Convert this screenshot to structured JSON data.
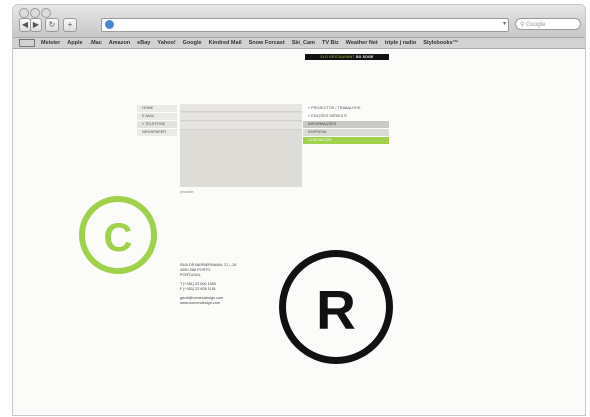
{
  "browser": {
    "search_placeholder": "Google",
    "bookmarks": [
      "Meister",
      "Apple",
      ".Mac",
      "Amazon",
      "eBay",
      "Yahoo!",
      "Google",
      "Kindred Mail",
      "Snow Forcast",
      "Ski_Cam",
      "TV Biz",
      "Weather Net",
      "triple j radio",
      "Stylebooks™"
    ]
  },
  "site": {
    "topbar_prefix": "ELO RESTAURANT",
    "topbar_highlight": "DO SOGE",
    "left_menu": [
      "HOME",
      "E-MAIL",
      "« TELEFONE",
      "NEWSPAPER"
    ],
    "right_menu": [
      {
        "label": "» PROJECTOS / TRABALHOS",
        "style": "light"
      },
      {
        "label": "» EDIÇÕES SÉRIES R",
        "style": "light"
      },
      {
        "label": "INFORMAÇÕES",
        "style": "grey"
      },
      {
        "label": "EMPRESA",
        "style": "grey2"
      },
      {
        "label": "CONTACTOS",
        "style": "green"
      }
    ],
    "caption": "printable",
    "logo_c_letter": "C",
    "logo_r_letter": "R",
    "address": {
      "line1": "RUA DR BARBERNAMA, 27—18",
      "line2": "4050-068 PORTO",
      "line3": "PORTUGAL",
      "phone": "T [+351] 22 606 1050",
      "fax": "F [+351] 22 606 1151",
      "email": "geral@nomendesign.com",
      "web": "www.nomendesign.com"
    },
    "colors": {
      "accent_green": "#9fd24a",
      "dark": "#111111"
    }
  }
}
